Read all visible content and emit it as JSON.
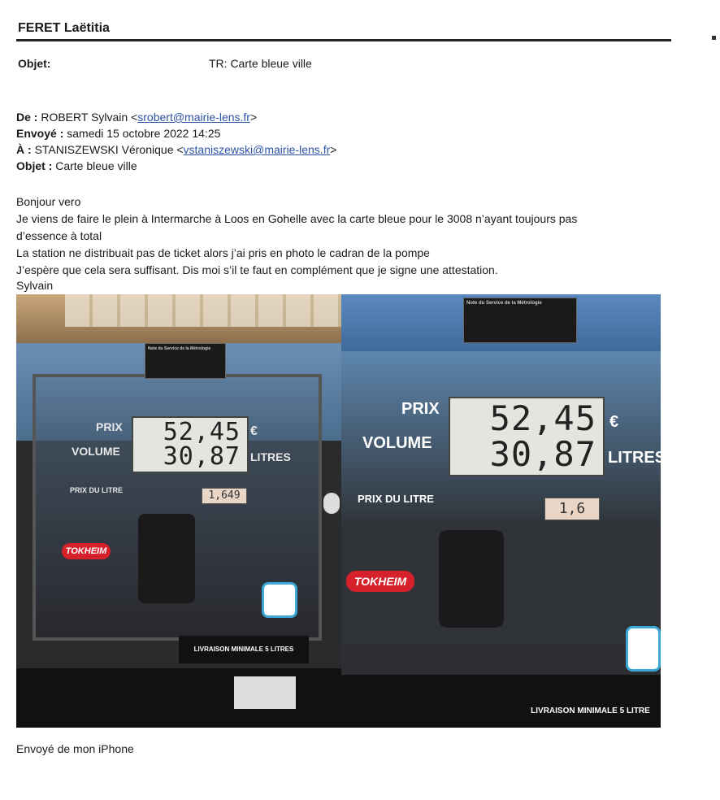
{
  "header": {
    "sender": "FERET Laëtitia",
    "subject_label": "Objet:",
    "subject": "TR: Carte bleue ville"
  },
  "forward": {
    "from_label": "De :",
    "from_name": "ROBERT Sylvain <",
    "from_email": "srobert@mairie-lens.fr",
    "from_close": ">",
    "sent_label": "Envoyé :",
    "sent": "samedi 15 octobre 2022 14:25",
    "to_label": "À :",
    "to_name": "STANISZEWSKI Véronique <",
    "to_email": "vstaniszewski@mairie-lens.fr",
    "to_close": ">",
    "subject_label": "Objet :",
    "subject": "Carte bleue ville"
  },
  "body": {
    "lines": [
      "Bonjour vero",
      "Je viens de faire le plein à Intermarche à Loos en Gohelle avec la carte bleue pour le 3008 n’ayant toujours pas",
      "d’essence à total",
      "La station ne distribuait pas de ticket alors j’ai pris en photo le cadran de la pompe",
      "J’espère que cela sera suffisant. Dis moi s’il te faut en complément que je signe une attestation.",
      "Sylvain"
    ]
  },
  "pump": {
    "price_label": "PRIX",
    "volume_label": "VOLUME",
    "price": "52,45",
    "volume": "30,87",
    "currency": "€",
    "litres": "LITRES",
    "unit_label": "PRIX DU LITRE",
    "unit_price_1": "1,649",
    "unit_price_2": "1,6",
    "brand": "TOKHEIM",
    "min_delivery": "LIVRAISON MINIMALE 5 LITRES",
    "min_delivery_2": "LIVRAISON MINIMALE 5 LITRE",
    "notice_title": "Note du Service de la Métrologie"
  },
  "footer": {
    "signature": "Envoyé de mon iPhone"
  },
  "colors": {
    "link": "#2b53a8",
    "brand_red": "#d6202b"
  }
}
